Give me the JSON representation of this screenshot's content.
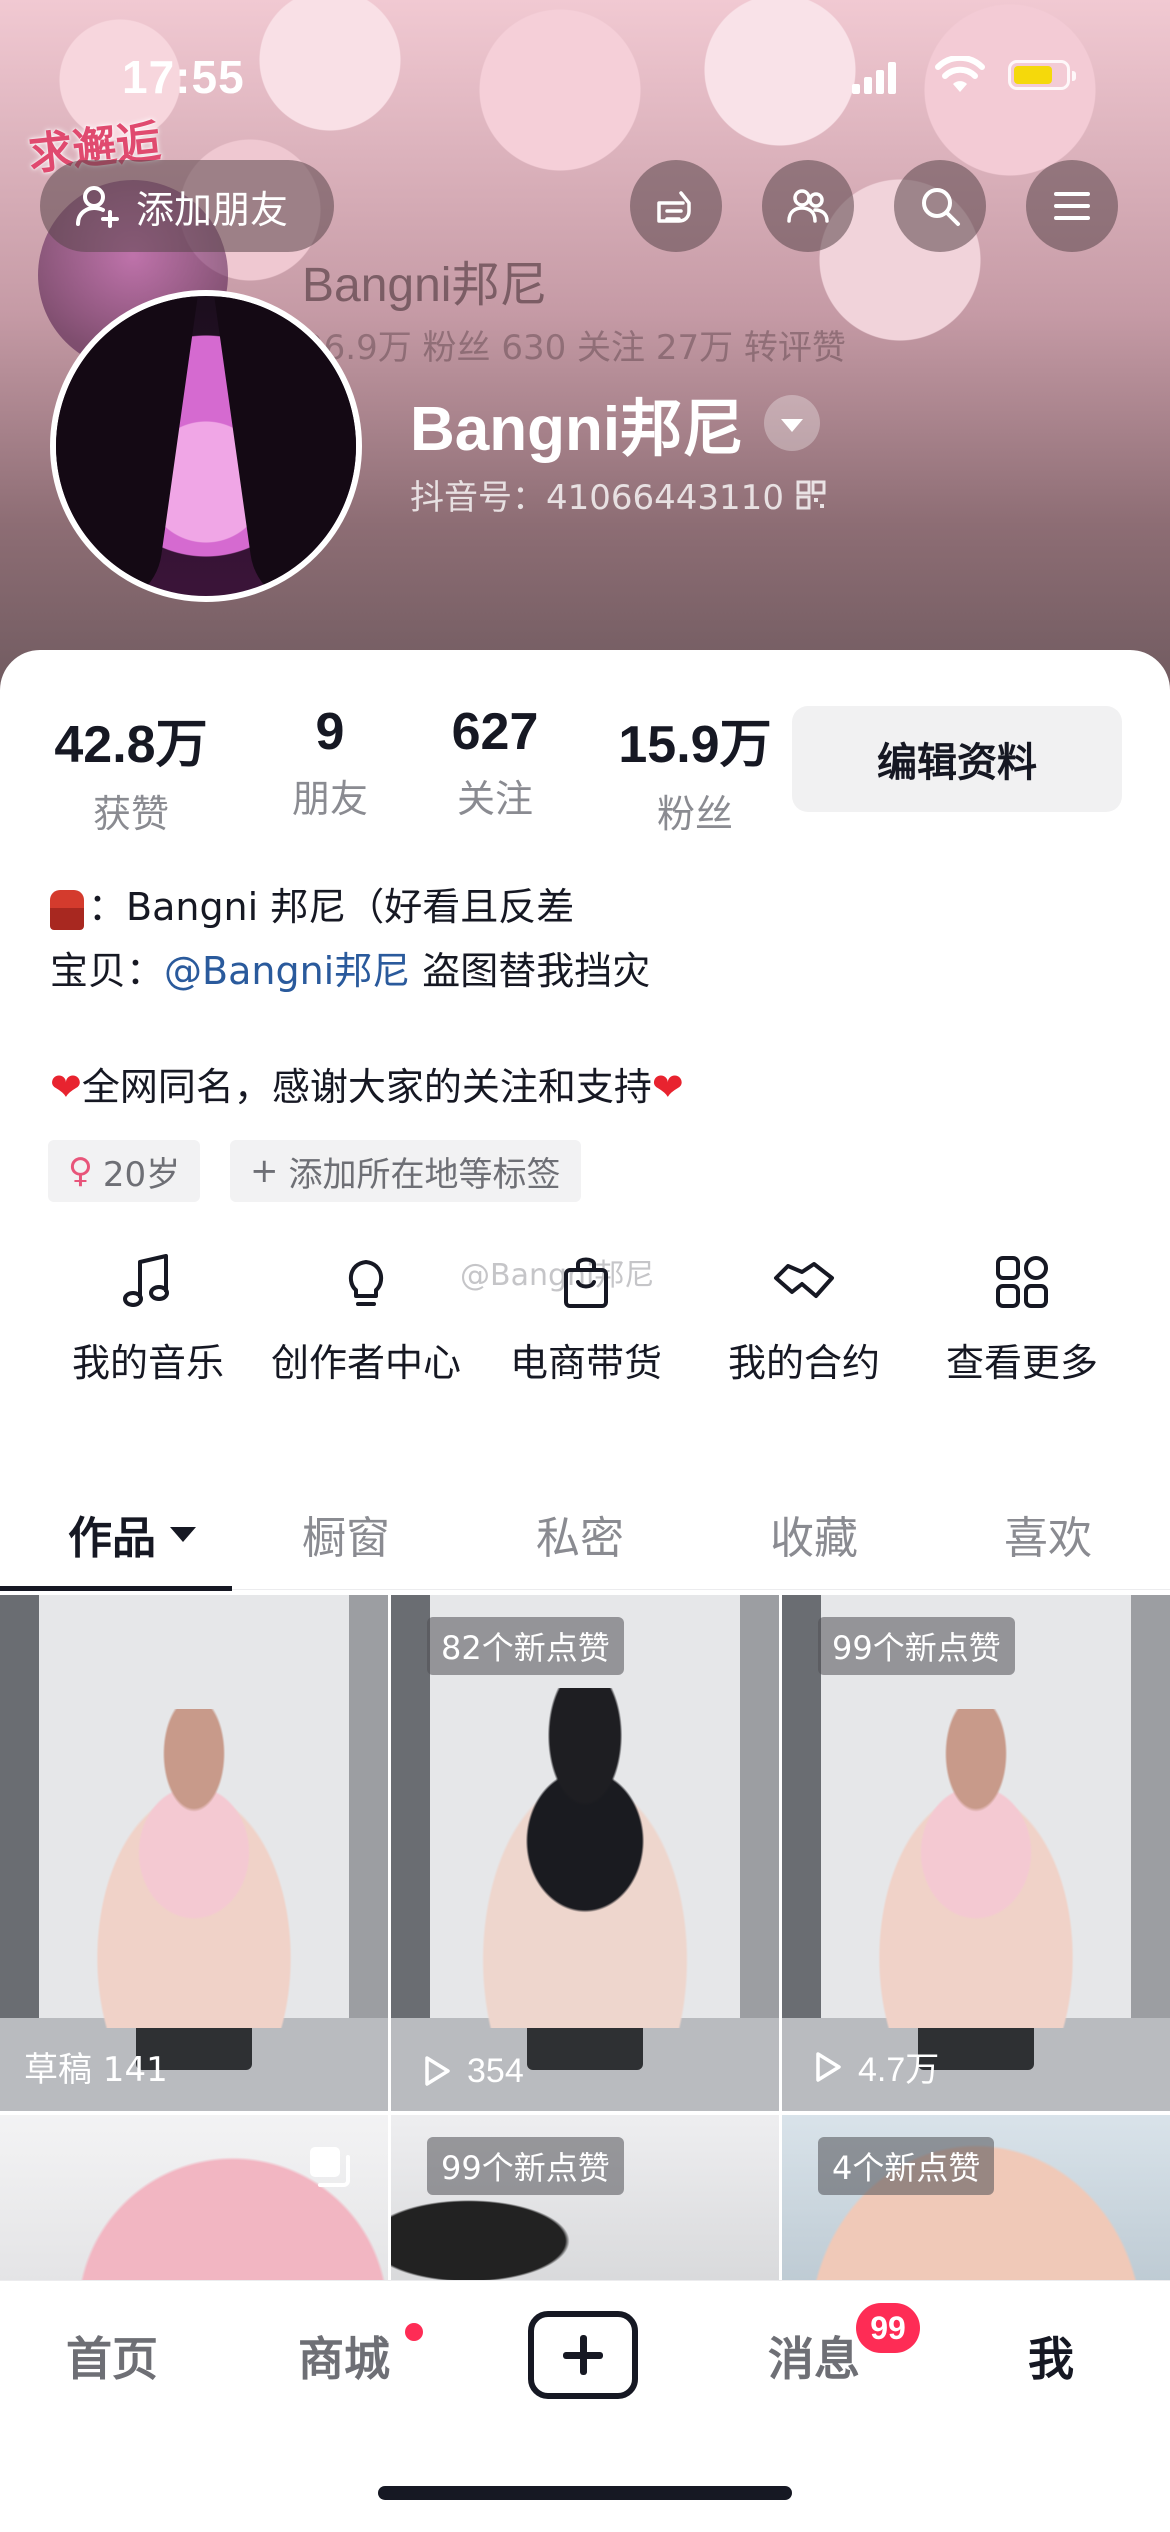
{
  "status_bar": {
    "time": "17:55"
  },
  "header": {
    "sticker_text": "求邂逅",
    "add_friend_label": "添加朋友",
    "background_echo": {
      "name": "Bangni邦尼",
      "stats": "26.9万 粉丝   630 关注   27万 转评赞"
    }
  },
  "profile": {
    "nickname": "Bangni邦尼",
    "douyin_id": "抖音号：41066443110"
  },
  "stats": [
    {
      "value": "42.8万",
      "label": "获赞"
    },
    {
      "value": "9",
      "label": "朋友"
    },
    {
      "value": "627",
      "label": "关注"
    },
    {
      "value": "15.9万",
      "label": "粉丝"
    }
  ],
  "edit_profile_label": "编辑资料",
  "bio": {
    "line1_text": "：Bangni 邦尼（好看且反差",
    "line2_prefix": "宝贝：",
    "line2_mention": "@Bangni邦尼",
    "line2_suffix": " 盗图替我挡灾",
    "line3_text": "全网同名，感谢大家的关注和支持"
  },
  "tags": {
    "age": "20岁",
    "add_location": "添加所在地等标签"
  },
  "watermark": "@Bangni邦尼",
  "tools": [
    {
      "label": "我的音乐",
      "icon": "music-note-icon"
    },
    {
      "label": "创作者中心",
      "icon": "lightbulb-icon"
    },
    {
      "label": "电商带货",
      "icon": "shopping-bag-icon"
    },
    {
      "label": "我的合约",
      "icon": "handshake-icon"
    },
    {
      "label": "查看更多",
      "icon": "grid-icon"
    }
  ],
  "tabs": [
    {
      "label": "作品",
      "active": true
    },
    {
      "label": "橱窗"
    },
    {
      "label": "私密"
    },
    {
      "label": "收藏"
    },
    {
      "label": "喜欢"
    }
  ],
  "videos": [
    {
      "badge": "",
      "meta": "草稿 141"
    },
    {
      "badge": "82个新点赞",
      "meta": "354"
    },
    {
      "badge": "99个新点赞",
      "meta": "4.7万"
    },
    {
      "badge": "",
      "meta": ""
    },
    {
      "badge": "99个新点赞",
      "meta": ""
    },
    {
      "badge": "4个新点赞",
      "meta": ""
    }
  ],
  "bottom_nav": {
    "home": "首页",
    "mall": "商城",
    "messages": "消息",
    "messages_badge": "99",
    "me": "我"
  },
  "colors": {
    "accent_red": "#fe2c55",
    "mention_blue": "#2a5a9c",
    "battery_yellow": "#f5d90b"
  }
}
